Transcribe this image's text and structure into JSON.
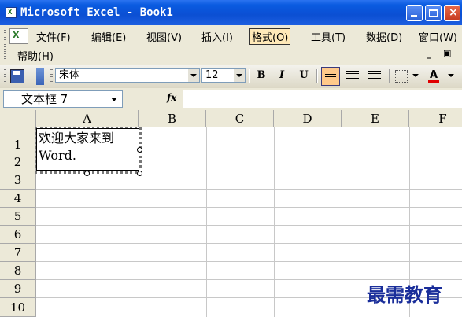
{
  "window": {
    "title": "Microsoft Excel - Book1",
    "icon_letter": "X"
  },
  "menubar": {
    "items": [
      "文件(F)",
      "编辑(E)",
      "视图(V)",
      "插入(I)",
      "格式(O)",
      "工具(T)",
      "数据(D)",
      "窗口(W)",
      "帮助(H)"
    ],
    "active": "格式(O)"
  },
  "toolbar": {
    "font_name": "宋体",
    "font_size": "12",
    "bold": "B",
    "italic": "I",
    "underline": "U",
    "font_color_letter": "A"
  },
  "formula_bar": {
    "name_box": "文本框 7",
    "fx": "fx",
    "content": ""
  },
  "sheet": {
    "columns": [
      "A",
      "B",
      "C",
      "D",
      "E",
      "F"
    ],
    "rows": [
      "1",
      "2",
      "3",
      "4",
      "5",
      "6",
      "7",
      "8",
      "9",
      "10"
    ]
  },
  "textbox": {
    "text": "欢迎大家来到\nWord."
  },
  "watermark": "最需教育",
  "colors": {
    "titlebar": "#0b4fd3",
    "toolbar_bg": "#ece9d8",
    "active_menu": "#ffe9b8",
    "watermark": "#1a2e9a"
  }
}
